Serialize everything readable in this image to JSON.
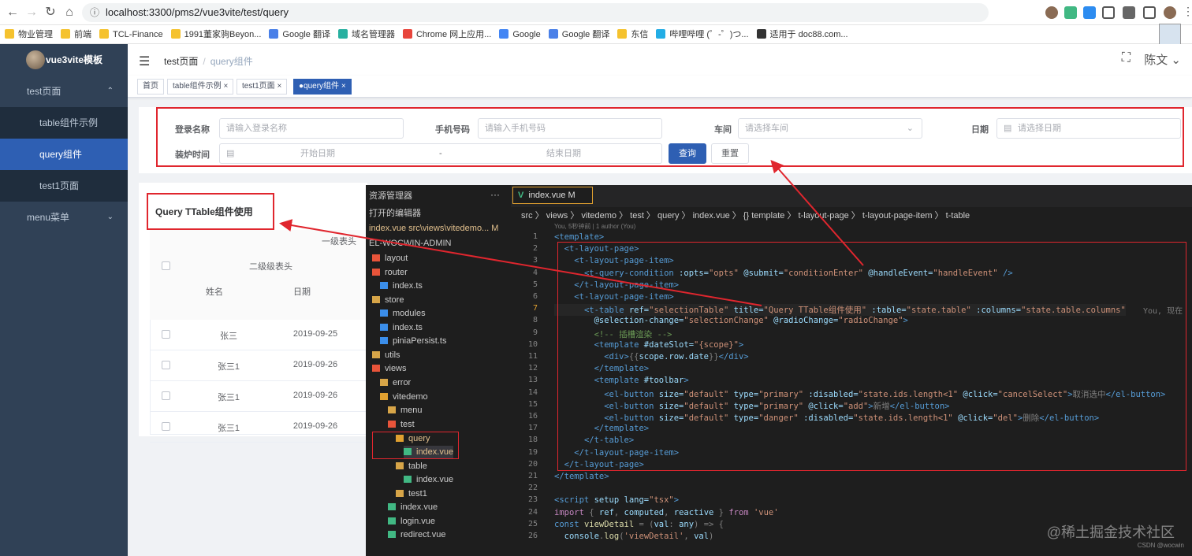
{
  "browser": {
    "url": "localhost:3300/pms2/vue3vite/test/query",
    "back": "←",
    "forward": "→",
    "reload": "↻",
    "home": "⌂",
    "info": "ⓘ",
    "bookmarks": [
      {
        "label": "物业管理",
        "color": "#f5c22e"
      },
      {
        "label": "前端",
        "color": "#f5c22e"
      },
      {
        "label": "TCL-Finance",
        "color": "#f5c22e"
      },
      {
        "label": "1991董家驹Beyon...",
        "color": "#f5c22e"
      },
      {
        "label": "Google 翻译",
        "color": "#4a80e8"
      },
      {
        "label": "域名管理器",
        "color": "#28b0a0"
      },
      {
        "label": "Chrome 网上应用...",
        "color": "#e8453c"
      },
      {
        "label": "Google",
        "color": "#4285f4"
      },
      {
        "label": "Google 翻译",
        "color": "#4a80e8"
      },
      {
        "label": "东信",
        "color": "#f5c22e"
      },
      {
        "label": "哔哩哔哩 (゜-゜)つ...",
        "color": "#23ade5"
      },
      {
        "label": "适用于 doc88.com...",
        "color": "#333333"
      }
    ]
  },
  "sidebar": {
    "logo": "vue3vite模板",
    "items": [
      {
        "label": "test页面",
        "kind": "top",
        "chev": "⌃"
      },
      {
        "label": "table组件示例",
        "kind": "sub"
      },
      {
        "label": "query组件",
        "kind": "sub active"
      },
      {
        "label": "test1页面",
        "kind": "sub"
      },
      {
        "label": "menu菜单",
        "kind": "top",
        "chev": "⌄"
      }
    ]
  },
  "header": {
    "menu_icon": "☰",
    "breadcrumb": [
      "test页面",
      "query组件"
    ],
    "sep": "/",
    "user": "陈文 ⌄",
    "fullscreen": "⛶"
  },
  "tags": [
    {
      "label": "首页"
    },
    {
      "label": "table组件示例 ×"
    },
    {
      "label": "test1页面 ×"
    },
    {
      "label": "●query组件 ×",
      "active": true
    }
  ],
  "query": {
    "login_label": "登录名称",
    "login_ph": "请输入登录名称",
    "phone_label": "手机号码",
    "phone_ph": "请输入手机号码",
    "car_label": "车间",
    "car_ph": "请选择车间",
    "date_label": "日期",
    "date_ph": "请选择日期",
    "furnace_label": "装炉时间",
    "start_ph": "开始日期",
    "dash": "-",
    "end_ph": "结束日期",
    "search": "查询",
    "reset": "重置"
  },
  "table": {
    "title": "Query TTable组件使用",
    "level1": "一级表头",
    "level2": "二级级表头",
    "col_name": "姓名",
    "col_date": "日期",
    "rows": [
      {
        "name": "张三",
        "date": "2019-09-25"
      },
      {
        "name": "张三1",
        "date": "2019-09-26"
      },
      {
        "name": "张三1",
        "date": "2019-09-26"
      },
      {
        "name": "张三1",
        "date": "2019-09-26"
      }
    ]
  },
  "vscode": {
    "explorer": [
      {
        "t": "资源管理器",
        "d": 0
      },
      {
        "t": "打开的编辑器",
        "d": 0
      },
      {
        "t": "index.vue  src\\views\\vitedemo...  M",
        "d": 0
      },
      {
        "t": "EL-WOCWIN-ADMIN",
        "d": 0
      },
      {
        "t": "layout",
        "d": 0
      },
      {
        "t": "router",
        "d": 0
      },
      {
        "t": "index.ts",
        "d": 1
      },
      {
        "t": "store",
        "d": 0
      },
      {
        "t": "modules",
        "d": 1
      },
      {
        "t": "index.ts",
        "d": 1
      },
      {
        "t": "piniaPersist.ts",
        "d": 1
      },
      {
        "t": "utils",
        "d": 0
      },
      {
        "t": "views",
        "d": 0
      },
      {
        "t": "error",
        "d": 1
      },
      {
        "t": "vitedemo",
        "d": 1
      },
      {
        "t": "menu",
        "d": 2
      },
      {
        "t": "test",
        "d": 2
      },
      {
        "t": "query",
        "d": 3
      },
      {
        "t": "index.vue",
        "d": 4
      },
      {
        "t": "table",
        "d": 3
      },
      {
        "t": "index.vue",
        "d": 4
      },
      {
        "t": "test1",
        "d": 3
      },
      {
        "t": "index.vue",
        "d": 2
      },
      {
        "t": "login.vue",
        "d": 2
      },
      {
        "t": "redirect.vue",
        "d": 2
      }
    ],
    "tab": "index.vue  M",
    "breadcrumb": "src 〉 views 〉 vitedemo 〉 test 〉 query 〉 index.vue 〉 {} template 〉 t-layout-page 〉 t-layout-page-item 〉 t-table",
    "blame": "You, 5秒钟前 | 1 author (You)",
    "inline_blame": "You, 现在",
    "lines": [
      [
        [
          "tg",
          "<template>"
        ]
      ],
      [
        [
          "pu",
          "  "
        ],
        [
          "tg",
          "<t-layout-page>"
        ]
      ],
      [
        [
          "pu",
          "    "
        ],
        [
          "tg",
          "<t-layout-page-item>"
        ]
      ],
      [
        [
          "pu",
          "      "
        ],
        [
          "tg",
          "<t-query-condition "
        ],
        [
          "at",
          ":opts="
        ],
        [
          "st",
          "\"opts\" "
        ],
        [
          "at",
          "@submit="
        ],
        [
          "st",
          "\"conditionEnter\" "
        ],
        [
          "at",
          "@handleEvent="
        ],
        [
          "st",
          "\"handleEvent\" "
        ],
        [
          "tg",
          "/>"
        ]
      ],
      [
        [
          "pu",
          "    "
        ],
        [
          "tg",
          "</t-layout-page-item>"
        ]
      ],
      [
        [
          "pu",
          "    "
        ],
        [
          "tg",
          "<t-layout-page-item>"
        ]
      ],
      [
        [
          "pu",
          "      "
        ],
        [
          "tg",
          "<t-table "
        ],
        [
          "at",
          "ref="
        ],
        [
          "st",
          "\"selectionTable\" "
        ],
        [
          "at",
          "title="
        ],
        [
          "st",
          "\"Query TTable组件使用\" "
        ],
        [
          "at",
          ":table="
        ],
        [
          "st",
          "\"state.table\" "
        ],
        [
          "at",
          ":columns="
        ],
        [
          "st",
          "\"state.table.columns\""
        ]
      ],
      [
        [
          "pu",
          "        "
        ],
        [
          "at",
          "@selection-change="
        ],
        [
          "st",
          "\"selectionChange\" "
        ],
        [
          "at",
          "@radioChange="
        ],
        [
          "st",
          "\"radioChange\""
        ],
        [
          "tg",
          ">"
        ]
      ],
      [
        [
          "pu",
          "        "
        ],
        [
          "cm",
          "<!-- 插槽渲染 -->"
        ]
      ],
      [
        [
          "pu",
          "        "
        ],
        [
          "tg",
          "<template "
        ],
        [
          "at",
          "#dateSlot="
        ],
        [
          "st",
          "\"{scope}\""
        ],
        [
          "tg",
          ">"
        ]
      ],
      [
        [
          "pu",
          "          "
        ],
        [
          "tg",
          "<div>"
        ],
        [
          "pu",
          "{{"
        ],
        [
          "at",
          "scope.row.date"
        ],
        [
          "pu",
          "}}"
        ],
        [
          "tg",
          "</div>"
        ]
      ],
      [
        [
          "pu",
          "        "
        ],
        [
          "tg",
          "</template>"
        ]
      ],
      [
        [
          "pu",
          "        "
        ],
        [
          "tg",
          "<template "
        ],
        [
          "at",
          "#toolbar"
        ],
        [
          "tg",
          ">"
        ]
      ],
      [
        [
          "pu",
          "          "
        ],
        [
          "tg",
          "<el-button "
        ],
        [
          "at",
          "size="
        ],
        [
          "st",
          "\"default\" "
        ],
        [
          "at",
          "type="
        ],
        [
          "st",
          "\"primary\" "
        ],
        [
          "at",
          ":disabled="
        ],
        [
          "st",
          "\"state.ids.length<1\" "
        ],
        [
          "at",
          "@click="
        ],
        [
          "st",
          "\"cancelSelect\""
        ],
        [
          "tg",
          ">"
        ],
        [
          "pu",
          "取消选中"
        ],
        [
          "tg",
          "</el-button>"
        ]
      ],
      [
        [
          "pu",
          "          "
        ],
        [
          "tg",
          "<el-button "
        ],
        [
          "at",
          "size="
        ],
        [
          "st",
          "\"default\" "
        ],
        [
          "at",
          "type="
        ],
        [
          "st",
          "\"primary\" "
        ],
        [
          "at",
          "@click="
        ],
        [
          "st",
          "\"add\""
        ],
        [
          "tg",
          ">"
        ],
        [
          "pu",
          "新增"
        ],
        [
          "tg",
          "</el-button>"
        ]
      ],
      [
        [
          "pu",
          "          "
        ],
        [
          "tg",
          "<el-button "
        ],
        [
          "at",
          "size="
        ],
        [
          "st",
          "\"default\" "
        ],
        [
          "at",
          "type="
        ],
        [
          "st",
          "\"danger\" "
        ],
        [
          "at",
          ":disabled="
        ],
        [
          "st",
          "\"state.ids.length<1\" "
        ],
        [
          "at",
          "@click="
        ],
        [
          "st",
          "\"del\""
        ],
        [
          "tg",
          ">"
        ],
        [
          "pu",
          "删除"
        ],
        [
          "tg",
          "</el-button>"
        ]
      ],
      [
        [
          "pu",
          "        "
        ],
        [
          "tg",
          "</template>"
        ]
      ],
      [
        [
          "pu",
          "      "
        ],
        [
          "tg",
          "</t-table>"
        ]
      ],
      [
        [
          "pu",
          "    "
        ],
        [
          "tg",
          "</t-layout-page-item>"
        ]
      ],
      [
        [
          "pu",
          "  "
        ],
        [
          "tg",
          "</t-layout-page>"
        ]
      ],
      [
        [
          "tg",
          "</template>"
        ]
      ],
      [
        [
          "pu",
          ""
        ]
      ],
      [
        [
          "tg",
          "<script "
        ],
        [
          "at",
          "setup lang="
        ],
        [
          "st",
          "\"tsx\""
        ],
        [
          "tg",
          ">"
        ]
      ],
      [
        [
          "kw",
          "import "
        ],
        [
          "pu",
          "{ "
        ],
        [
          "at",
          "ref"
        ],
        [
          "pu",
          ", "
        ],
        [
          "at",
          "computed"
        ],
        [
          "pu",
          ", "
        ],
        [
          "at",
          "reactive"
        ],
        [
          "pu",
          " } "
        ],
        [
          "kw",
          "from "
        ],
        [
          "st",
          "'vue'"
        ]
      ],
      [
        [
          "tg",
          "const "
        ],
        [
          "fn",
          "viewDetail"
        ],
        [
          "pu",
          " = ("
        ],
        [
          "at",
          "val"
        ],
        [
          "pu",
          ": "
        ],
        [
          "at",
          "any"
        ],
        [
          "pu",
          ") => {"
        ]
      ],
      [
        [
          "pu",
          "  "
        ],
        [
          "at",
          "console"
        ],
        [
          "pu",
          "."
        ],
        [
          "fn",
          "log"
        ],
        [
          "pu",
          "("
        ],
        [
          "st",
          "'viewDetail'"
        ],
        [
          "pu",
          ", "
        ],
        [
          "at",
          "val"
        ],
        [
          "pu",
          ")"
        ]
      ]
    ]
  },
  "watermark": "@稀土掘金技术社区",
  "csdn": "CSDN @wocwin"
}
